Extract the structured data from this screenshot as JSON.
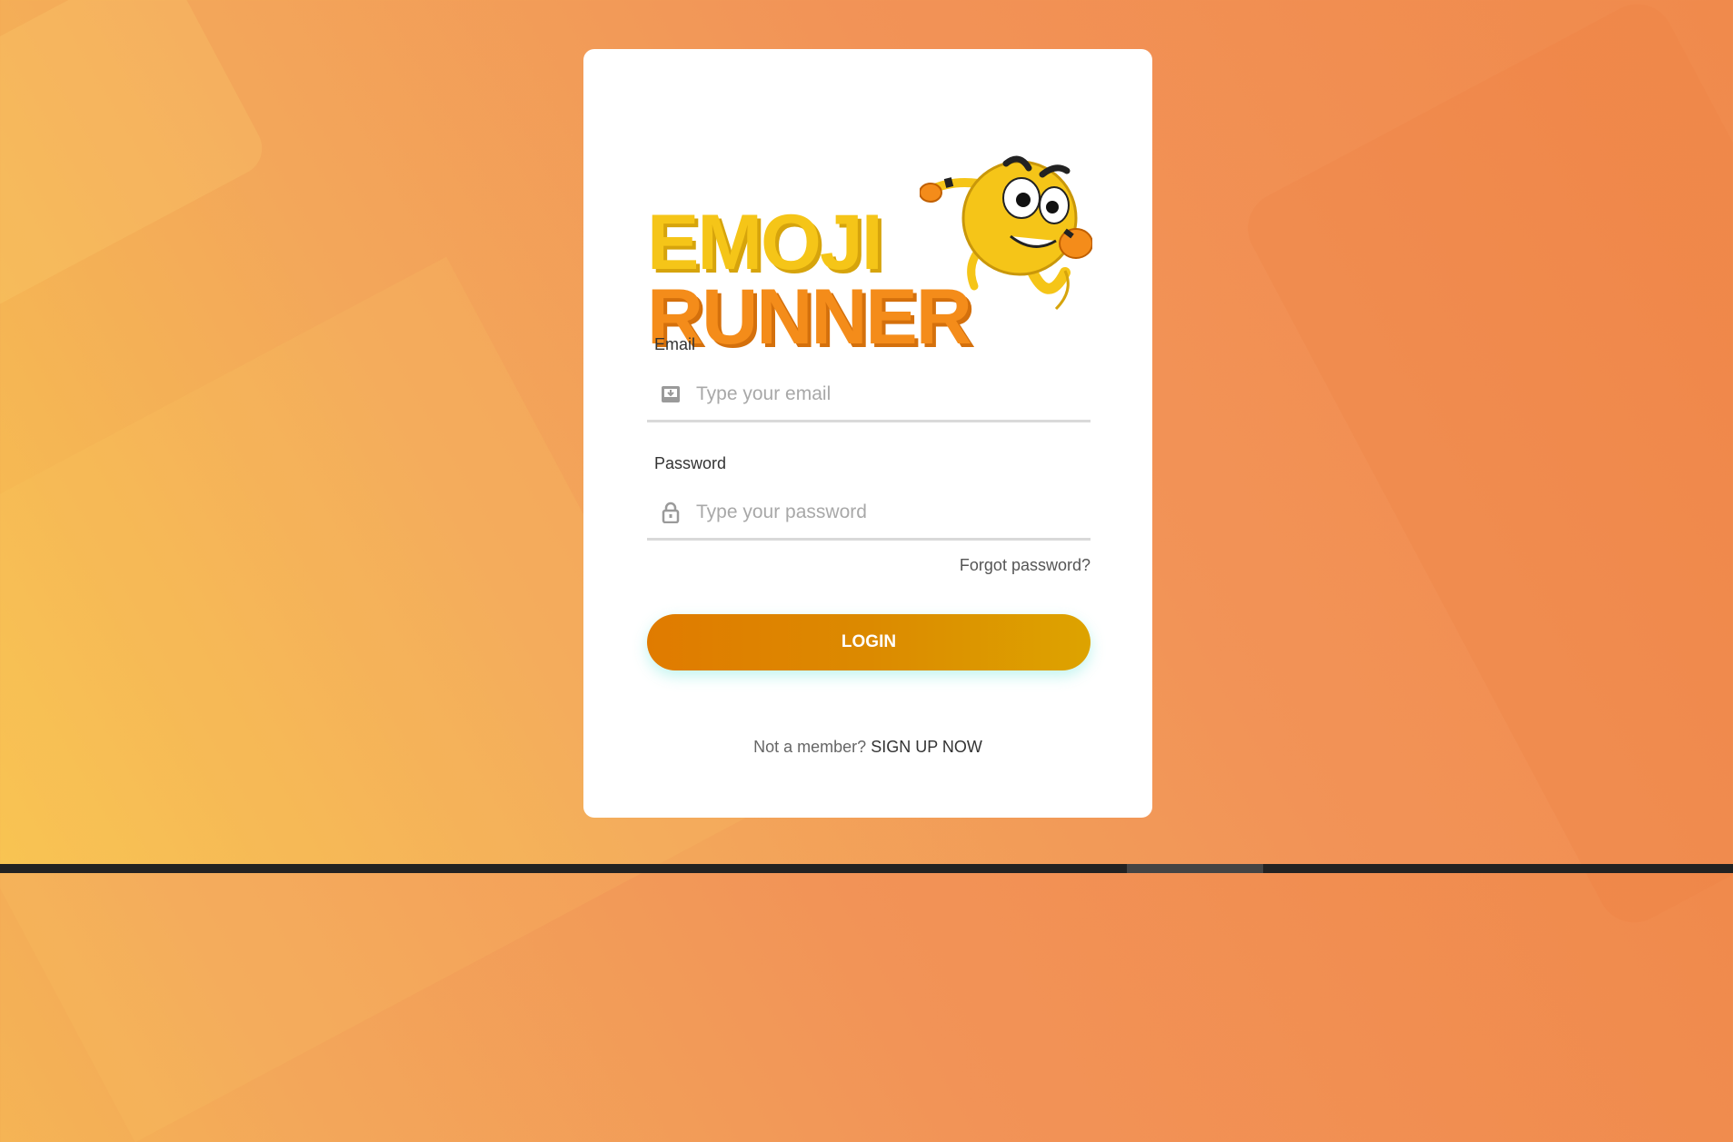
{
  "logo": {
    "line1": "EMOJI",
    "line2": "RUNNER",
    "mascot_icon": "running-emoji-mascot"
  },
  "email": {
    "label": "Email",
    "placeholder": "Type your email",
    "value": "",
    "icon": "inbox-icon"
  },
  "password": {
    "label": "Password",
    "placeholder": "Type your password",
    "value": "",
    "icon": "lock-icon"
  },
  "forgot_label": "Forgot password?",
  "login_label": "LOGIN",
  "signup": {
    "prompt": "Not a member?",
    "link": "SIGN UP NOW"
  },
  "colors": {
    "accent": "#e07b00",
    "logo_yellow": "#f5c518",
    "logo_orange": "#f48c1a"
  }
}
